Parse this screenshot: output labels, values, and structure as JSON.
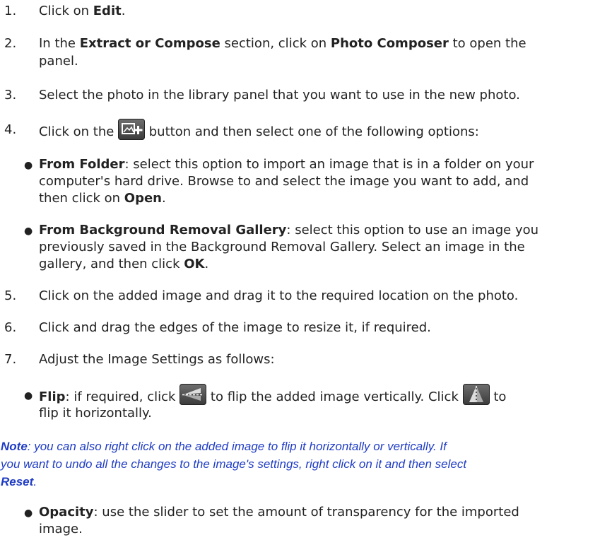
{
  "steps": [
    {
      "num": "1.",
      "pre": "Click on ",
      "b1": "Edit",
      "post": "."
    },
    {
      "num": "2.",
      "pre": "In the ",
      "b1": "Extract or Compose",
      "mid": " section, click on ",
      "b2": "Photo Composer",
      "post": " to open the",
      "post2": "panel."
    },
    {
      "num": "3.",
      "text": "Select the photo in the library panel that you want to use in the new photo."
    },
    {
      "num": "4.",
      "pre": "Click on the ",
      "icon": "add-image-icon",
      "post": " button and then select one of the following options:"
    },
    {
      "num": "5.",
      "text": "Click on the added image and drag it to the required location on the photo."
    },
    {
      "num": "6.",
      "text": "Click and drag the edges of the image to resize it, if required."
    },
    {
      "num": "7.",
      "text": "Adjust the Image Settings as follows:"
    }
  ],
  "options": [
    {
      "bold": "From Folder",
      "text1": ": select this option to import an image that is in a folder on your",
      "text2": "computer's hard drive. Browse to and select the image you want to add, and",
      "text3pre": "then click on ",
      "text3b": "Open",
      "text3post": "."
    },
    {
      "bold": "From Background Removal Gallery",
      "text1": ": select this option to use an image you",
      "text2": "previously saved in the Background Removal Gallery. Select an image in the",
      "text3pre": "gallery, and then click ",
      "text3b": "OK",
      "text3post": "."
    }
  ],
  "settings": {
    "flip": {
      "bold": "Flip",
      "pre": ": if required, click ",
      "mid": " to flip the added image vertically. Click ",
      "post": " to",
      "line2": "flip it horizontally.",
      "icon_v": "flip-vertical-icon",
      "icon_h": "flip-horizontal-icon"
    },
    "opacity": {
      "bold": "Opacity",
      "text1": ": use the slider to set the amount of transparency for the imported",
      "text2": "image."
    }
  },
  "note": {
    "label": "Note",
    "line1": ": you can also right click on the added image to flip it horizontally or vertically. If",
    "line2": "you want to undo all the changes to the image's settings, right click on it and then select",
    "reset": "Reset",
    "end": "."
  },
  "colors": {
    "note": "#1f3cc4",
    "text": "#222222",
    "icon": "#4a4a4a"
  }
}
